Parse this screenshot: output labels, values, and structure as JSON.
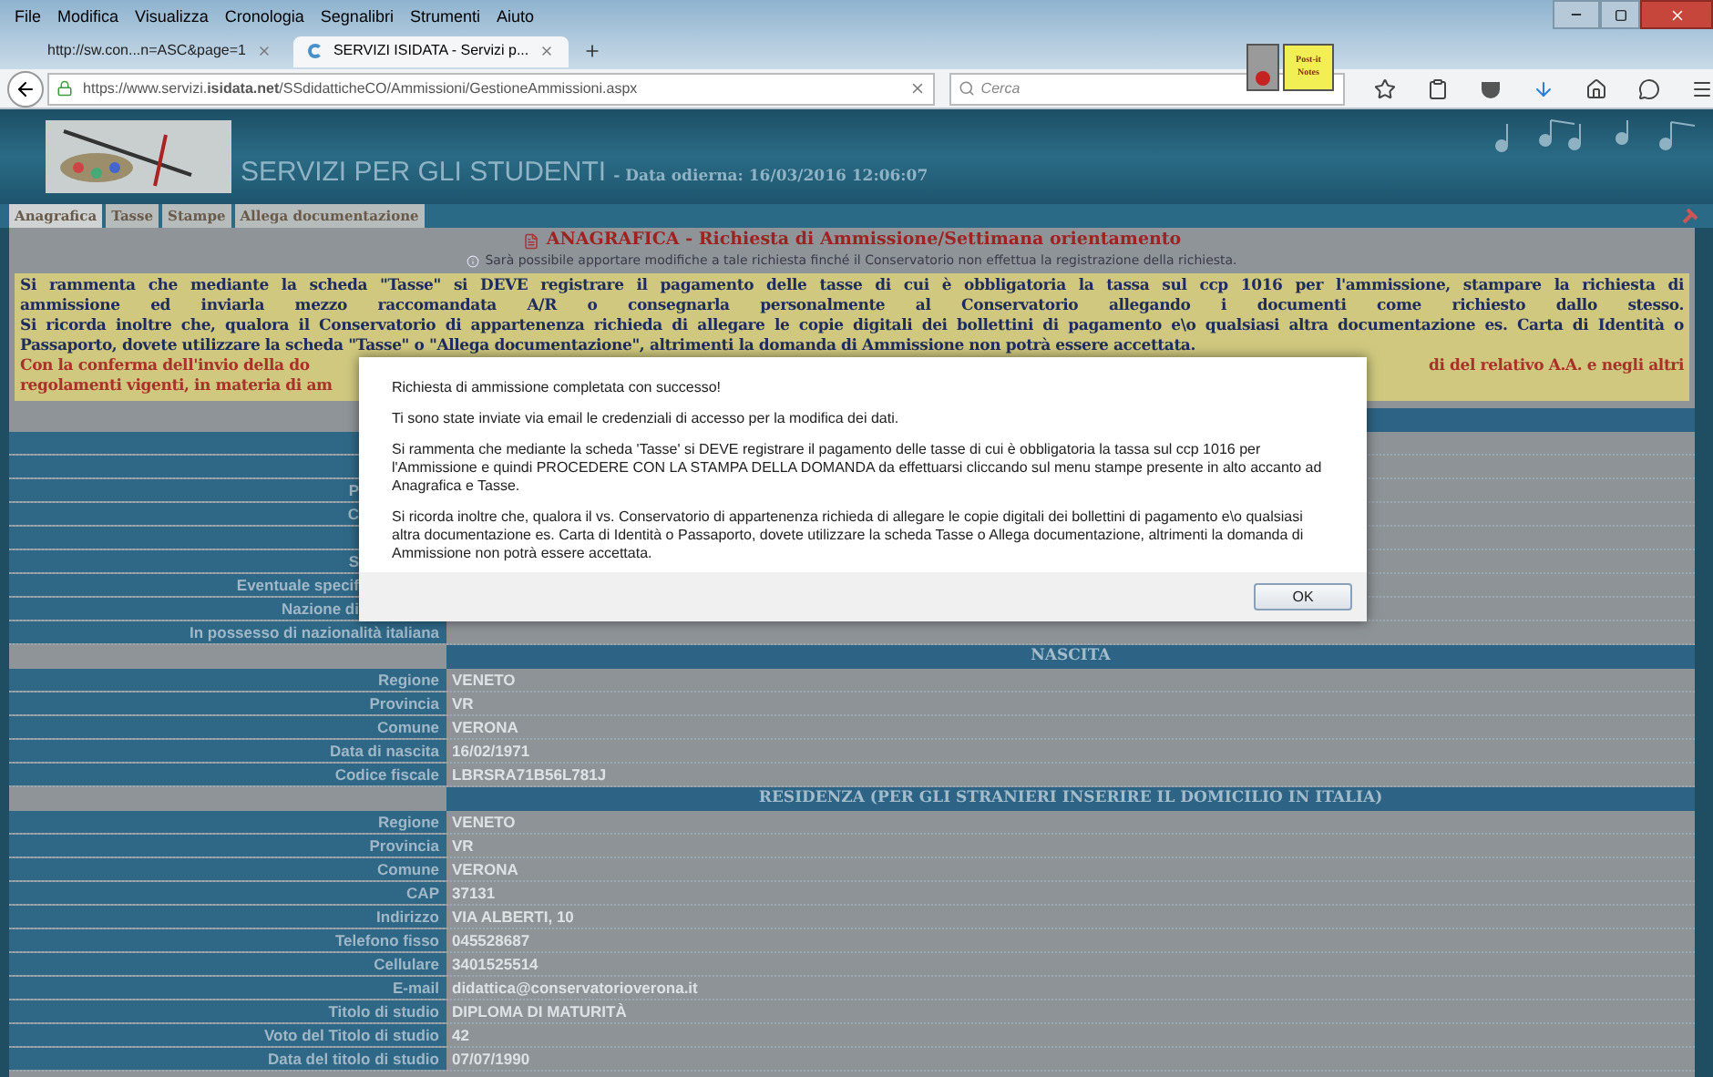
{
  "browser": {
    "menu": [
      "File",
      "Modifica",
      "Visualizza",
      "Cronologia",
      "Segnalibri",
      "Strumenti",
      "Aiuto"
    ],
    "tabs": [
      {
        "label": "http://sw.con...n=ASC&page=1",
        "selected": false
      },
      {
        "label": "SERVIZI ISIDATA - Servizi p...",
        "selected": true
      }
    ],
    "url": "https://www.servizi.**isidata.net**/SSdidatticheCO/Ammissioni/GestioneAmmissioni.aspx",
    "search": {
      "placeholder": "Cerca"
    },
    "sticky_note": [
      "Post-it",
      "Notes"
    ]
  },
  "header": {
    "title": "SERVIZI PER GLI STUDENTI",
    "date": "- Data odierna: 16/03/2016 12:06:07"
  },
  "page_tabs": [
    {
      "label": "Anagrafica",
      "selected": true
    },
    {
      "label": "Tasse",
      "selected": false
    },
    {
      "label": "Stampe",
      "selected": false
    },
    {
      "label": "Allega documentazione",
      "selected": false
    }
  ],
  "content": {
    "title": "ANAGRAFICA - Richiesta di Ammissione/Settimana orientamento",
    "subtitle": "Sarà possibile apportare modifiche a tale richiesta finché il Conservatorio non effettua la registrazione della richiesta.",
    "notice": [
      {
        "kind": "info",
        "text": "Si rammenta che mediante la scheda \"Tasse\" si DEVE registrare il pagamento delle tasse di cui è obbligatoria la tassa sul ccp 1016 per l'ammissione, stampare la richiesta di"
      },
      {
        "kind": "info",
        "text": "ammissione ed inviarla mezzo raccomandata A/R o consegnarla personalmente al Conservatorio allegando i documenti come richiesto dallo stesso."
      },
      {
        "kind": "info",
        "text": "Si ricorda inoltre che, qualora il Conservatorio di appartenenza richieda di allegare le copie digitali dei bollettini di pagamento e\\o qualsiasi altra documentazione es. Carta di Identità o"
      },
      {
        "kind": "info",
        "text": "Passaporto, dovete utilizzare la scheda \"Tasse\" o \"Allega documentazione\", altrimenti la domanda di Ammissione non potrà essere accettata."
      },
      {
        "kind": "warning",
        "text": "Con la conferma dell'invio della do",
        "text_right": "di del relativo A.A. e negli altri"
      },
      {
        "kind": "warning",
        "text": "regolamenti vigenti, in materia di am"
      }
    ]
  },
  "form": {
    "rows": [
      {
        "kind": "header"
      },
      {
        "kind": "partial"
      },
      {
        "kind": "partial"
      },
      {
        "kind": "partial",
        "label": "P"
      },
      {
        "kind": "partial",
        "label": "C"
      },
      {
        "kind": "partial"
      },
      {
        "kind": "partial",
        "label": "S"
      },
      {
        "kind": "partial",
        "label": "Eventuale specif"
      },
      {
        "kind": "partial",
        "label": "Nazione di"
      },
      {
        "kind": "field",
        "label": "In possesso di nazionalità italiana"
      },
      {
        "kind": "header",
        "label": "NASCITA"
      },
      {
        "kind": "field",
        "label": "Regione",
        "value": "VENETO"
      },
      {
        "kind": "field",
        "label": "Provincia",
        "value": "VR"
      },
      {
        "kind": "field",
        "label": "Comune",
        "value": "VERONA"
      },
      {
        "kind": "field",
        "label": "Data di nascita",
        "value": "16/02/1971"
      },
      {
        "kind": "field",
        "label": "Codice fiscale",
        "value": "LBRSRA71B56L781J"
      },
      {
        "kind": "header",
        "label": "RESIDENZA (PER GLI STRANIERI INSERIRE IL DOMICILIO IN ITALIA)"
      },
      {
        "kind": "field",
        "label": "Regione",
        "value": "VENETO"
      },
      {
        "kind": "field",
        "label": "Provincia",
        "value": "VR"
      },
      {
        "kind": "field",
        "label": "Comune",
        "value": "VERONA"
      },
      {
        "kind": "field",
        "label": "CAP",
        "value": "37131"
      },
      {
        "kind": "field",
        "label": "Indirizzo",
        "value": "VIA ALBERTI, 10"
      },
      {
        "kind": "field",
        "label": "Telefono fisso",
        "value": "045528687"
      },
      {
        "kind": "field",
        "label": "Cellulare",
        "value": "3401525514"
      },
      {
        "kind": "field",
        "label": "E-mail",
        "value": "didattica@conservatorioverona.it"
      },
      {
        "kind": "field",
        "label": "Titolo di studio",
        "value": "DIPLOMA DI MATURITÀ"
      },
      {
        "kind": "field",
        "label": "Voto del Titolo di studio",
        "value": "42"
      },
      {
        "kind": "field",
        "label": "Data del titolo di studio",
        "value": "07/07/1990"
      }
    ]
  },
  "dialog": {
    "paragraphs": [
      "Richiesta di ammissione completata con successo!",
      "Ti sono state inviate via email le credenziali di accesso per la modifica dei dati.",
      "Si rammenta che mediante la scheda 'Tasse' si DEVE registrare il pagamento delle tasse di cui è obbligatoria la tassa sul ccp 1016 per l'Ammissione e quindi PROCEDERE CON LA STAMPA DELLA DOMANDA da effettuarsi cliccando sul menu stampe presente in alto accanto ad Anagrafica e Tasse.",
      "Si ricorda inoltre che, qualora il vs. Conservatorio di appartenenza richieda di allegare le copie digitali dei bollettini di pagamento e\\o qualsiasi altra documentazione es. Carta di Identità o Passaporto, dovete utilizzare la scheda Tasse o Allega documentazione, altrimenti la domanda di Ammissione non potrà essere accettata."
    ],
    "ok": "OK"
  }
}
